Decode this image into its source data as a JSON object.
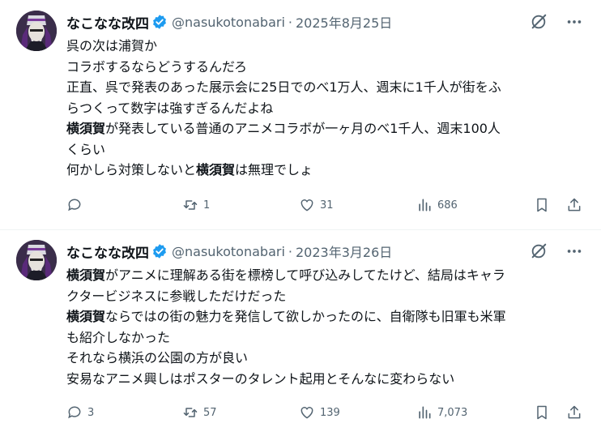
{
  "tweets": [
    {
      "author": "なこなな改四",
      "handle": "@nasukotonabari",
      "separator": "·",
      "date": "2025年8月25日",
      "lines": [
        [
          {
            "t": "呉の次は浦賀か"
          }
        ],
        [
          {
            "t": "コラボするならどうするんだろ"
          }
        ],
        [
          {
            "t": "正直、呉で発表のあった展示会に25日でのべ1万人、週末に1千人が街をふ"
          }
        ],
        [
          {
            "t": "らつくって数字は強すぎるんだよね"
          }
        ],
        [
          {
            "t": "横須賀",
            "b": true
          },
          {
            "t": "が発表している普通のアニメコラボが一ヶ月のべ1千人、週末100人"
          }
        ],
        [
          {
            "t": "くらい"
          }
        ],
        [
          {
            "t": "何かしら対策しないと"
          },
          {
            "t": "横須賀",
            "b": true
          },
          {
            "t": "は無理でしょ"
          }
        ]
      ],
      "stats": {
        "replies": "",
        "reposts": "1",
        "likes": "31",
        "views": "686"
      }
    },
    {
      "author": "なこなな改四",
      "handle": "@nasukotonabari",
      "separator": "·",
      "date": "2023年3月26日",
      "lines": [
        [
          {
            "t": "横須賀",
            "b": true
          },
          {
            "t": "がアニメに理解ある街を標榜して呼び込みしてたけど、結局はキャラ"
          }
        ],
        [
          {
            "t": "クタービジネスに参戦しただけだった"
          }
        ],
        [
          {
            "t": "横須賀",
            "b": true
          },
          {
            "t": "ならではの街の魅力を発信して欲しかったのに、自衛隊も旧軍も米軍"
          }
        ],
        [
          {
            "t": "も紹介しなかった"
          }
        ],
        [
          {
            "t": "それなら横浜の公園の方が良い"
          }
        ],
        [
          {
            "t": "安易なアニメ興しはポスターのタレント起用とそんなに変わらない"
          }
        ]
      ],
      "stats": {
        "replies": "3",
        "reposts": "57",
        "likes": "139",
        "views": "7,073"
      }
    }
  ],
  "icons": {
    "verified": "verified-badge-icon",
    "grok": "grok-icon",
    "more": "more-dots-icon",
    "reply": "reply-icon",
    "repost": "repost-icon",
    "like": "heart-icon",
    "views": "views-icon",
    "bookmark": "bookmark-icon",
    "share": "share-icon"
  },
  "colors": {
    "text": "#0f1419",
    "secondary": "#536471",
    "verified": "#1d9bf0",
    "divider": "#eff3f4"
  }
}
